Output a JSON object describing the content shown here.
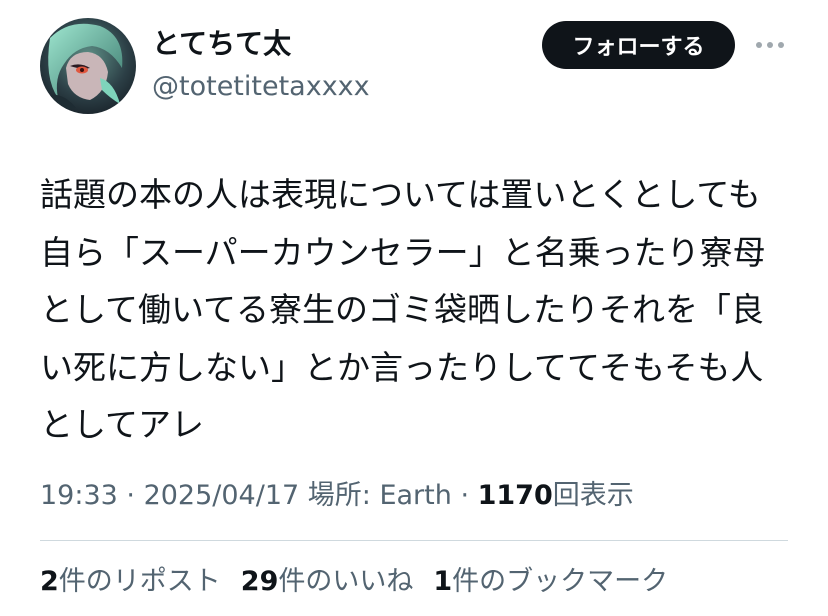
{
  "author": {
    "display_name": "とてちて太",
    "handle": "@totetitetaxxxx",
    "avatar_icon": "avatar-image"
  },
  "header": {
    "follow_label": "フォローする",
    "more_icon": "more-dots-icon"
  },
  "tweet": {
    "lines": [
      "話題の本の人は表現については置いとくとしても",
      "自ら「スーパーカウンセラー」と名乗ったり寮母",
      "として働いてる寮生のゴミ袋晒したりそれを「良",
      "い死に方しない」とか言ったりしててそもそも人",
      "としてアレ"
    ]
  },
  "meta": {
    "time": "19:33",
    "sep1": " · ",
    "date": "2025/04/17",
    "location": " 場所: Earth",
    "sep2": " · ",
    "views": "1170",
    "views_label": "回表示"
  },
  "stats": {
    "reposts_count": "2",
    "reposts_label": "件のリポスト",
    "likes_count": "29",
    "likes_label": "件のいいね",
    "bookmarks_count": "1",
    "bookmarks_label": "件のブックマーク"
  },
  "colors": {
    "text": "#0f1419",
    "secondary": "#536471",
    "divider": "#cfd9de",
    "button_bg": "#0f1419"
  }
}
